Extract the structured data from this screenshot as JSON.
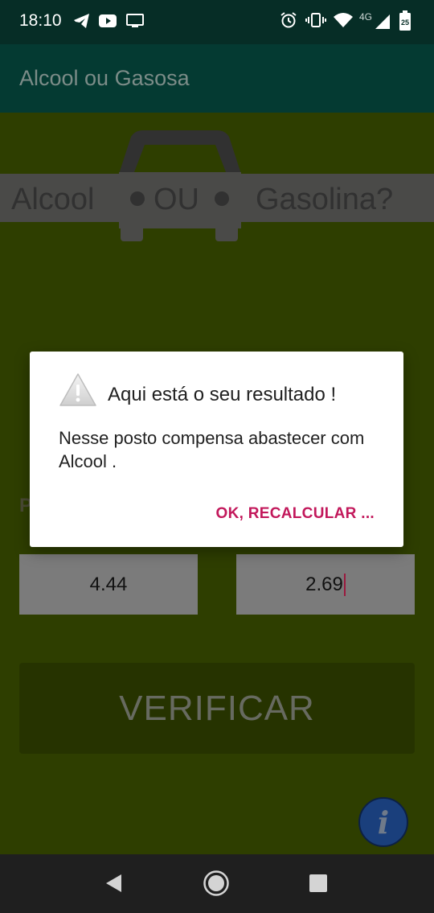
{
  "status_bar": {
    "time": "18:10",
    "network_type": "4G",
    "battery_level": "25",
    "left_icons": [
      "telegram-icon",
      "youtube-icon",
      "cast-icon"
    ],
    "right_icons": [
      "alarm-icon",
      "vibrate-icon",
      "wifi-icon",
      "signal-icon",
      "battery-icon"
    ]
  },
  "app_bar": {
    "title": "Alcool ou Gasosa",
    "background": "#043a32"
  },
  "logo": {
    "left_word": "Alcool",
    "middle_word": "OU",
    "right_word": "Gasolina?"
  },
  "form": {
    "obscured_label": "P",
    "alcool_value": "4.44",
    "gasolina_value": "2.69",
    "verify_label": "VERIFICAR"
  },
  "info_button": {
    "glyph": "i",
    "icon": "info-icon"
  },
  "dialog": {
    "title": "Aqui está o seu resultado !",
    "message": "Nesse posto compensa abastecer com Alcool .",
    "button_label": "OK, RECALCULAR ...",
    "accent_color": "#c2185b",
    "icon": "warning-icon"
  },
  "nav_bar": {
    "buttons": [
      "back-icon",
      "home-icon",
      "recents-icon"
    ]
  }
}
